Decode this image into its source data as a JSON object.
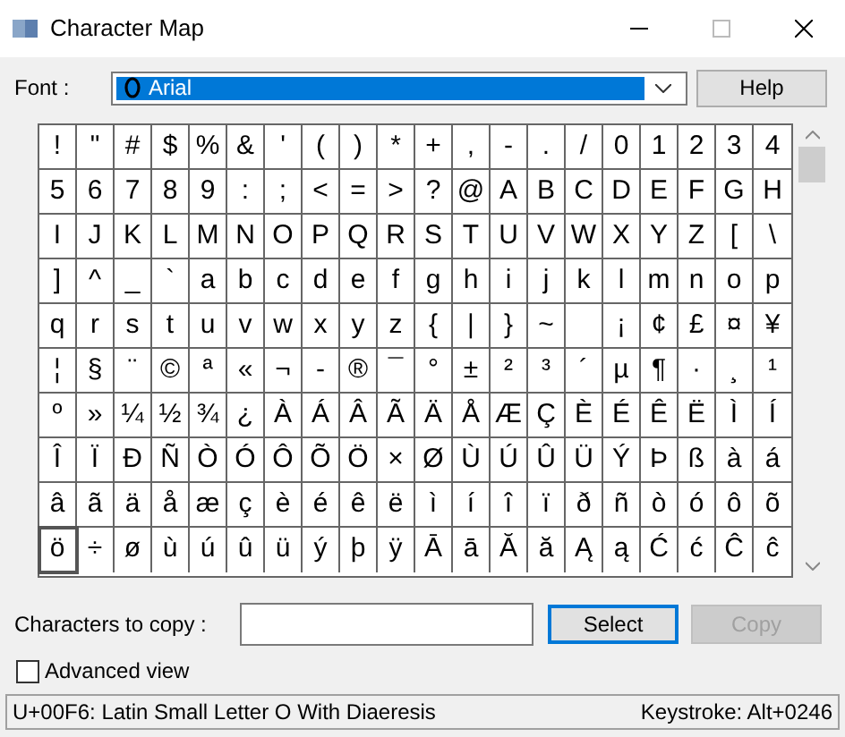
{
  "window": {
    "title": "Character Map"
  },
  "font": {
    "label": "Font :",
    "value": "Arial"
  },
  "help_button": "Help",
  "grid": [
    [
      {
        "char": "!",
        "selected": false
      },
      {
        "char": "\"",
        "selected": false
      },
      {
        "char": "#",
        "selected": false
      },
      {
        "char": "$",
        "selected": false
      },
      {
        "char": "%",
        "selected": false
      },
      {
        "char": "&",
        "selected": false
      },
      {
        "char": "'",
        "selected": false
      },
      {
        "char": "(",
        "selected": false
      },
      {
        "char": ")",
        "selected": false
      },
      {
        "char": "*",
        "selected": false
      },
      {
        "char": "+",
        "selected": false
      },
      {
        "char": ",",
        "selected": false
      },
      {
        "char": "-",
        "selected": false
      },
      {
        "char": ".",
        "selected": false
      },
      {
        "char": "/",
        "selected": false
      },
      {
        "char": "0",
        "selected": false
      },
      {
        "char": "1",
        "selected": false
      },
      {
        "char": "2",
        "selected": false
      },
      {
        "char": "3",
        "selected": false
      },
      {
        "char": "4",
        "selected": false
      }
    ],
    [
      {
        "char": "5",
        "selected": false
      },
      {
        "char": "6",
        "selected": false
      },
      {
        "char": "7",
        "selected": false
      },
      {
        "char": "8",
        "selected": false
      },
      {
        "char": "9",
        "selected": false
      },
      {
        "char": ":",
        "selected": false
      },
      {
        "char": ";",
        "selected": false
      },
      {
        "char": "<",
        "selected": false
      },
      {
        "char": "=",
        "selected": false
      },
      {
        "char": ">",
        "selected": false
      },
      {
        "char": "?",
        "selected": false
      },
      {
        "char": "@",
        "selected": false
      },
      {
        "char": "A",
        "selected": false
      },
      {
        "char": "B",
        "selected": false
      },
      {
        "char": "C",
        "selected": false
      },
      {
        "char": "D",
        "selected": false
      },
      {
        "char": "E",
        "selected": false
      },
      {
        "char": "F",
        "selected": false
      },
      {
        "char": "G",
        "selected": false
      },
      {
        "char": "H",
        "selected": false
      }
    ],
    [
      {
        "char": "I",
        "selected": false
      },
      {
        "char": "J",
        "selected": false
      },
      {
        "char": "K",
        "selected": false
      },
      {
        "char": "L",
        "selected": false
      },
      {
        "char": "M",
        "selected": false
      },
      {
        "char": "N",
        "selected": false
      },
      {
        "char": "O",
        "selected": false
      },
      {
        "char": "P",
        "selected": false
      },
      {
        "char": "Q",
        "selected": false
      },
      {
        "char": "R",
        "selected": false
      },
      {
        "char": "S",
        "selected": false
      },
      {
        "char": "T",
        "selected": false
      },
      {
        "char": "U",
        "selected": false
      },
      {
        "char": "V",
        "selected": false
      },
      {
        "char": "W",
        "selected": false
      },
      {
        "char": "X",
        "selected": false
      },
      {
        "char": "Y",
        "selected": false
      },
      {
        "char": "Z",
        "selected": false
      },
      {
        "char": "[",
        "selected": false
      },
      {
        "char": "\\",
        "selected": false
      }
    ],
    [
      {
        "char": "]",
        "selected": false
      },
      {
        "char": "^",
        "selected": false
      },
      {
        "char": "_",
        "selected": false
      },
      {
        "char": "`",
        "selected": false
      },
      {
        "char": "a",
        "selected": false
      },
      {
        "char": "b",
        "selected": false
      },
      {
        "char": "c",
        "selected": false
      },
      {
        "char": "d",
        "selected": false
      },
      {
        "char": "e",
        "selected": false
      },
      {
        "char": "f",
        "selected": false
      },
      {
        "char": "g",
        "selected": false
      },
      {
        "char": "h",
        "selected": false
      },
      {
        "char": "i",
        "selected": false
      },
      {
        "char": "j",
        "selected": false
      },
      {
        "char": "k",
        "selected": false
      },
      {
        "char": "l",
        "selected": false
      },
      {
        "char": "m",
        "selected": false
      },
      {
        "char": "n",
        "selected": false
      },
      {
        "char": "o",
        "selected": false
      },
      {
        "char": "p",
        "selected": false
      }
    ],
    [
      {
        "char": "q",
        "selected": false
      },
      {
        "char": "r",
        "selected": false
      },
      {
        "char": "s",
        "selected": false
      },
      {
        "char": "t",
        "selected": false
      },
      {
        "char": "u",
        "selected": false
      },
      {
        "char": "v",
        "selected": false
      },
      {
        "char": "w",
        "selected": false
      },
      {
        "char": "x",
        "selected": false
      },
      {
        "char": "y",
        "selected": false
      },
      {
        "char": "z",
        "selected": false
      },
      {
        "char": "{",
        "selected": false
      },
      {
        "char": "|",
        "selected": false
      },
      {
        "char": "}",
        "selected": false
      },
      {
        "char": "~",
        "selected": false
      },
      {
        "selected": false
      },
      {
        "char": "¡",
        "selected": false
      },
      {
        "char": "¢",
        "selected": false
      },
      {
        "char": "£",
        "selected": false
      },
      {
        "char": "¤",
        "selected": false
      },
      {
        "char": "¥",
        "selected": false
      }
    ],
    [
      {
        "char": "¦",
        "selected": false
      },
      {
        "char": "§",
        "selected": false
      },
      {
        "char": "¨",
        "selected": false
      },
      {
        "char": "©",
        "selected": false
      },
      {
        "char": "ª",
        "selected": false
      },
      {
        "char": "«",
        "selected": false
      },
      {
        "char": "¬",
        "selected": false
      },
      {
        "char": "-",
        "selected": false
      },
      {
        "char": "®",
        "selected": false
      },
      {
        "char": "¯",
        "selected": false
      },
      {
        "char": "°",
        "selected": false
      },
      {
        "char": "±",
        "selected": false
      },
      {
        "char": "²",
        "selected": false
      },
      {
        "char": "³",
        "selected": false
      },
      {
        "char": "´",
        "selected": false
      },
      {
        "char": "µ",
        "selected": false
      },
      {
        "char": "¶",
        "selected": false
      },
      {
        "char": "·",
        "selected": false
      },
      {
        "char": "¸",
        "selected": false
      },
      {
        "char": "¹",
        "selected": false
      }
    ],
    [
      {
        "char": "º",
        "selected": false
      },
      {
        "char": "»",
        "selected": false
      },
      {
        "char": "¼",
        "selected": false
      },
      {
        "char": "½",
        "selected": false
      },
      {
        "char": "¾",
        "selected": false
      },
      {
        "char": "¿",
        "selected": false
      },
      {
        "char": "À",
        "selected": false
      },
      {
        "char": "Á",
        "selected": false
      },
      {
        "char": "Â",
        "selected": false
      },
      {
        "char": "Ã",
        "selected": false
      },
      {
        "char": "Ä",
        "selected": false
      },
      {
        "char": "Å",
        "selected": false
      },
      {
        "char": "Æ",
        "selected": false
      },
      {
        "char": "Ç",
        "selected": false
      },
      {
        "char": "È",
        "selected": false
      },
      {
        "char": "É",
        "selected": false
      },
      {
        "char": "Ê",
        "selected": false
      },
      {
        "char": "Ë",
        "selected": false
      },
      {
        "char": "Ì",
        "selected": false
      },
      {
        "char": "Í",
        "selected": false
      }
    ],
    [
      {
        "char": "Î",
        "selected": false
      },
      {
        "char": "Ï",
        "selected": false
      },
      {
        "char": "Ð",
        "selected": false
      },
      {
        "char": "Ñ",
        "selected": false
      },
      {
        "char": "Ò",
        "selected": false
      },
      {
        "char": "Ó",
        "selected": false
      },
      {
        "char": "Ô",
        "selected": false
      },
      {
        "char": "Õ",
        "selected": false
      },
      {
        "char": "Ö",
        "selected": false
      },
      {
        "char": "×",
        "selected": false
      },
      {
        "char": "Ø",
        "selected": false
      },
      {
        "char": "Ù",
        "selected": false
      },
      {
        "char": "Ú",
        "selected": false
      },
      {
        "char": "Û",
        "selected": false
      },
      {
        "char": "Ü",
        "selected": false
      },
      {
        "char": "Ý",
        "selected": false
      },
      {
        "char": "Þ",
        "selected": false
      },
      {
        "char": "ß",
        "selected": false
      },
      {
        "char": "à",
        "selected": false
      },
      {
        "char": "á",
        "selected": false
      }
    ],
    [
      {
        "char": "â",
        "selected": false
      },
      {
        "char": "ã",
        "selected": false
      },
      {
        "char": "ä",
        "selected": false
      },
      {
        "char": "å",
        "selected": false
      },
      {
        "char": "æ",
        "selected": false
      },
      {
        "char": "ç",
        "selected": false
      },
      {
        "char": "è",
        "selected": false
      },
      {
        "char": "é",
        "selected": false
      },
      {
        "char": "ê",
        "selected": false
      },
      {
        "char": "ë",
        "selected": false
      },
      {
        "char": "ì",
        "selected": false
      },
      {
        "char": "í",
        "selected": false
      },
      {
        "char": "î",
        "selected": false
      },
      {
        "char": "ï",
        "selected": false
      },
      {
        "char": "ð",
        "selected": false
      },
      {
        "char": "ñ",
        "selected": false
      },
      {
        "char": "ò",
        "selected": false
      },
      {
        "char": "ó",
        "selected": false
      },
      {
        "char": "ô",
        "selected": false
      },
      {
        "char": "õ",
        "selected": false
      }
    ],
    [
      {
        "char": "ö",
        "selected": true
      },
      {
        "char": "÷",
        "selected": false
      },
      {
        "char": "ø",
        "selected": false
      },
      {
        "char": "ù",
        "selected": false
      },
      {
        "char": "ú",
        "selected": false
      },
      {
        "char": "û",
        "selected": false
      },
      {
        "char": "ü",
        "selected": false
      },
      {
        "char": "ý",
        "selected": false
      },
      {
        "char": "þ",
        "selected": false
      },
      {
        "char": "ÿ",
        "selected": false
      },
      {
        "char": "Ā",
        "selected": false
      },
      {
        "char": "ā",
        "selected": false
      },
      {
        "char": "Ă",
        "selected": false
      },
      {
        "char": "ă",
        "selected": false
      },
      {
        "char": "Ą",
        "selected": false
      },
      {
        "char": "ą",
        "selected": false
      },
      {
        "char": "Ć",
        "selected": false
      },
      {
        "char": "ć",
        "selected": false
      },
      {
        "char": "Ĉ",
        "selected": false
      },
      {
        "char": "ĉ",
        "selected": false
      }
    ]
  ],
  "copy": {
    "label": "Characters to copy :",
    "select_button": "Select",
    "copy_button": {
      "label": "Copy",
      "disabled": true
    }
  },
  "advanced_view": {
    "label": "Advanced view",
    "checked": false
  },
  "status_bar": {
    "character": "U+00F6: Latin Small Letter O With Diaeresis",
    "keystroke": "Keystroke: Alt+0246"
  }
}
